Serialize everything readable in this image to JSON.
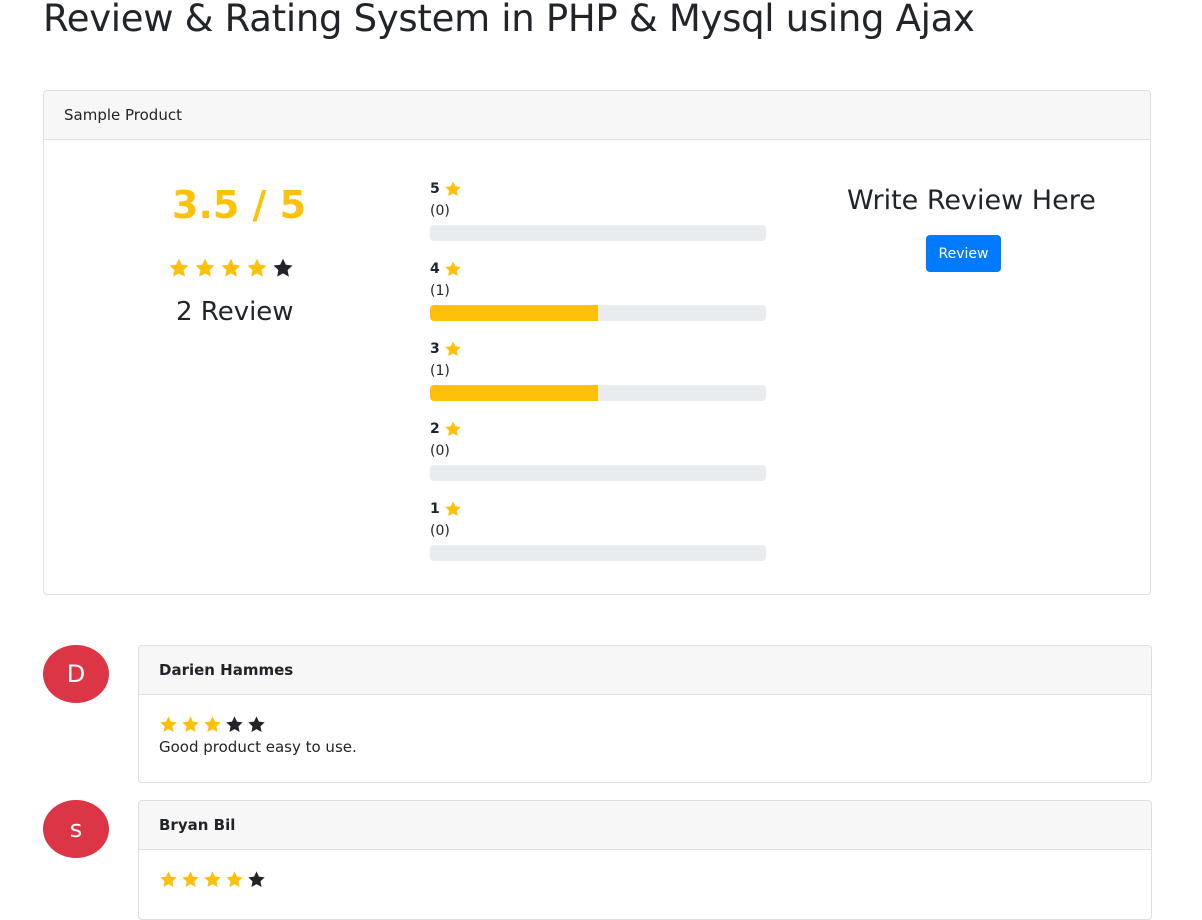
{
  "page": {
    "title": "Review & Rating System in PHP & Mysql using Ajax"
  },
  "product": {
    "header": "Sample Product",
    "average_text": "3.5 / 5",
    "average_stars": [
      true,
      true,
      true,
      true,
      false
    ],
    "review_count_text": "2 Review",
    "breakdown": [
      {
        "star": "5",
        "count": "(0)",
        "fraction": 0
      },
      {
        "star": "4",
        "count": "(1)",
        "fraction": 0.5
      },
      {
        "star": "3",
        "count": "(1)",
        "fraction": 0.5
      },
      {
        "star": "2",
        "count": "(0)",
        "fraction": 0
      },
      {
        "star": "1",
        "count": "(0)",
        "fraction": 0
      }
    ],
    "write_review_title": "Write Review Here",
    "review_button_label": "Review"
  },
  "reviews": [
    {
      "initial": "D",
      "name": "Darien Hammes",
      "stars": [
        true,
        true,
        true,
        false,
        false
      ],
      "text": "Good product easy to use."
    },
    {
      "initial": "s",
      "name": "Bryan Bil",
      "stars": [
        true,
        true,
        true,
        true,
        false
      ],
      "text": ""
    }
  ],
  "colors": {
    "star_filled": "#ffc107",
    "star_empty": "#212529",
    "accent": "#007bff",
    "avatar": "#dc3545"
  },
  "icons": {
    "star": "star-icon"
  }
}
